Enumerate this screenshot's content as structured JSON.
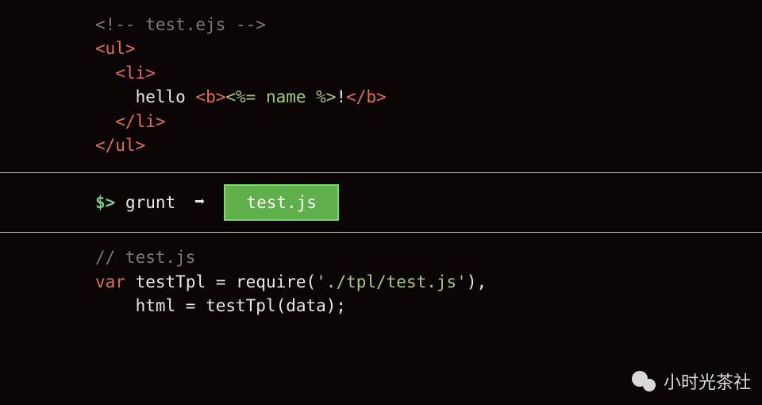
{
  "top": {
    "line1_comment": "<!-- test.ejs -->",
    "line2_ul_open": "<ul>",
    "line3_li_open": "<li>",
    "line4_text": "hello ",
    "line4_b_open": "<b>",
    "line4_ejs": "<%= name %>",
    "line4_bang": "!",
    "line4_b_close": "</b>",
    "line5_li_close": "</li>",
    "line6_ul_close": "</ul>"
  },
  "middle": {
    "prompt": "$>",
    "command": "grunt",
    "arrow": "➡",
    "badge": "test.js"
  },
  "bottom": {
    "line1_comment": "// test.js",
    "line2_kw": "var",
    "line2_a": " testTpl = require(",
    "line2_str": "'./tpl/test.js'",
    "line2_end": "),",
    "line3": "    html = testTpl(data);"
  },
  "watermark": "小时光茶社"
}
